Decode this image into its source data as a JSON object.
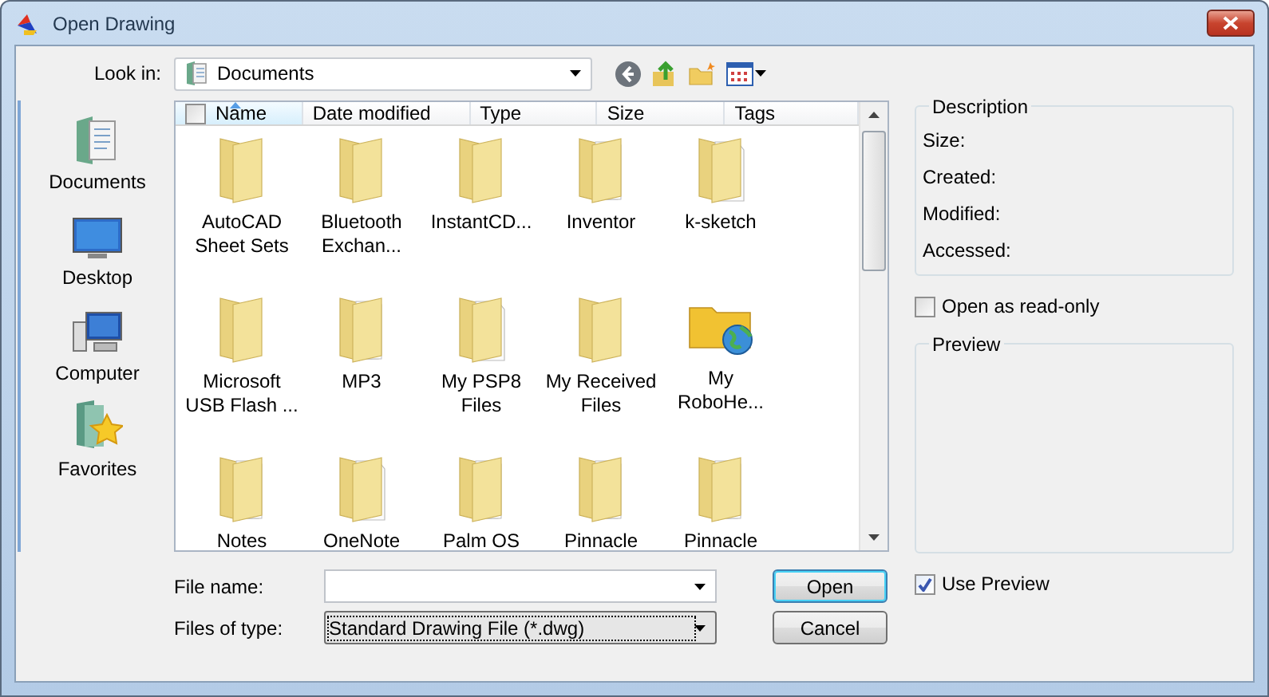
{
  "window": {
    "title": "Open Drawing"
  },
  "look_in": {
    "label": "Look in:",
    "value": "Documents"
  },
  "places": [
    {
      "label": "Documents",
      "kind": "documents"
    },
    {
      "label": "Desktop",
      "kind": "desktop"
    },
    {
      "label": "Computer",
      "kind": "computer"
    },
    {
      "label": "Favorites",
      "kind": "favorites"
    }
  ],
  "columns": [
    {
      "label": "Name",
      "sorted": true
    },
    {
      "label": "Date modified",
      "sorted": false
    },
    {
      "label": "Type",
      "sorted": false
    },
    {
      "label": "Size",
      "sorted": false
    },
    {
      "label": "Tags",
      "sorted": false
    }
  ],
  "items": [
    {
      "label": "AutoCAD\nSheet Sets",
      "kind": "plain"
    },
    {
      "label": "Bluetooth\nExchan...",
      "kind": "plain"
    },
    {
      "label": "InstantCD...",
      "kind": "plain"
    },
    {
      "label": "Inventor",
      "kind": "papers"
    },
    {
      "label": "k-sketch",
      "kind": "page"
    },
    {
      "label": "Microsoft\nUSB Flash ...",
      "kind": "plain"
    },
    {
      "label": "MP3",
      "kind": "papers"
    },
    {
      "label": "My PSP8\nFiles",
      "kind": "page"
    },
    {
      "label": "My Received\nFiles",
      "kind": "plain"
    },
    {
      "label": "My\nRoboHe...",
      "kind": "globe"
    },
    {
      "label": "Notes",
      "kind": "papers"
    },
    {
      "label": "OneNote",
      "kind": "page"
    },
    {
      "label": "Palm OS",
      "kind": "papers"
    },
    {
      "label": "Pinnacle",
      "kind": "papers"
    },
    {
      "label": "Pinnacle",
      "kind": "papers"
    }
  ],
  "file_name": {
    "label": "File name:"
  },
  "file_type": {
    "label": "Files of type:",
    "value": "Standard Drawing File (*.dwg)"
  },
  "buttons": [
    {
      "label": "Open",
      "default": true
    },
    {
      "label": "Cancel",
      "default": false
    }
  ],
  "description": {
    "title": "Description",
    "fields": [
      "Size:",
      "Created:",
      "Modified:",
      "Accessed:"
    ]
  },
  "read_only": {
    "label": "Open as read-only",
    "checked": false
  },
  "preview": {
    "title": "Preview"
  },
  "use_preview": {
    "label": "Use Preview",
    "checked": true
  }
}
